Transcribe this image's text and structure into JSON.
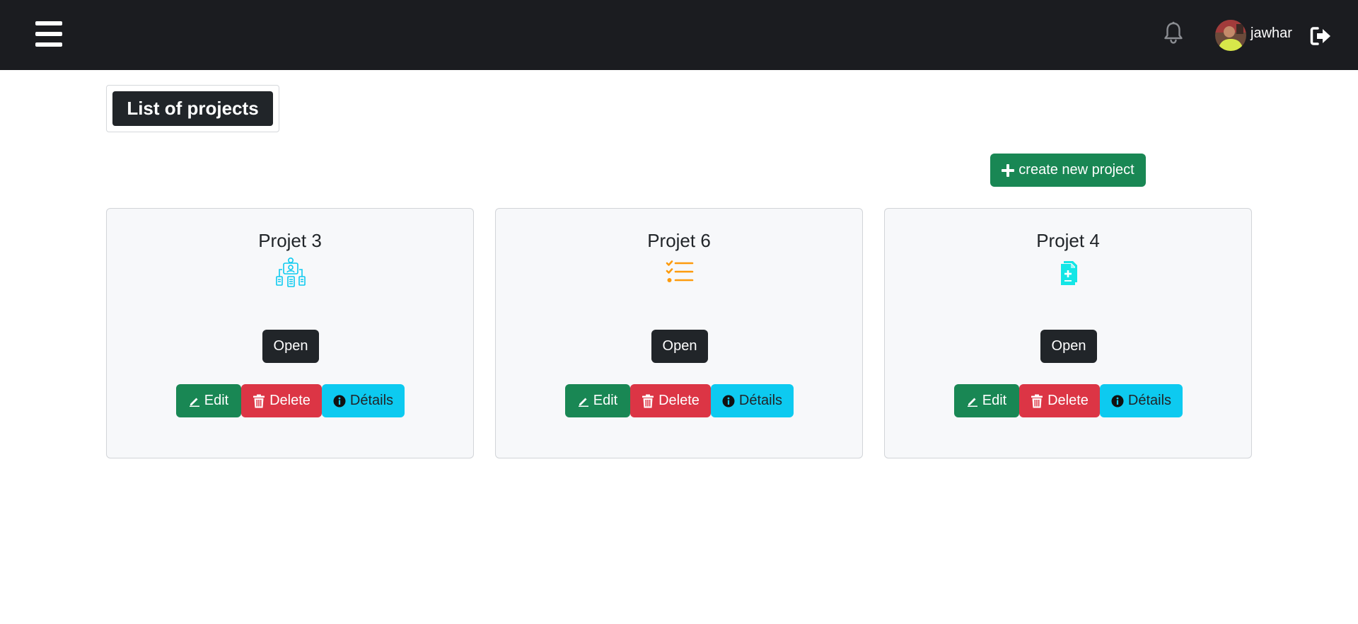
{
  "navbar": {
    "menu_icon": "hamburger-menu-icon",
    "notification_icon": "bell-icon",
    "username": "jawhar",
    "logout_icon": "logout-icon",
    "background_color": "#1b1c20"
  },
  "page": {
    "title": "List of projects",
    "create_button_label": "create new project"
  },
  "projects": [
    {
      "name": "Projet 3",
      "icon": "workflow-people-icon",
      "icon_color": "#0dcaf0",
      "open_label": "Open",
      "edit_label": "Edit",
      "delete_label": "Delete",
      "details_label": "Détails"
    },
    {
      "name": "Projet 6",
      "icon": "checklist-icon",
      "icon_color": "#fd9b0d",
      "open_label": "Open",
      "edit_label": "Edit",
      "delete_label": "Delete",
      "details_label": "Détails"
    },
    {
      "name": "Projet 4",
      "icon": "add-document-icon",
      "icon_color": "#14e6e6",
      "open_label": "Open",
      "edit_label": "Edit",
      "delete_label": "Delete",
      "details_label": "Détails"
    }
  ],
  "colors": {
    "success": "#198754",
    "danger": "#dc3545",
    "info": "#0dcaf0",
    "dark": "#212529"
  }
}
